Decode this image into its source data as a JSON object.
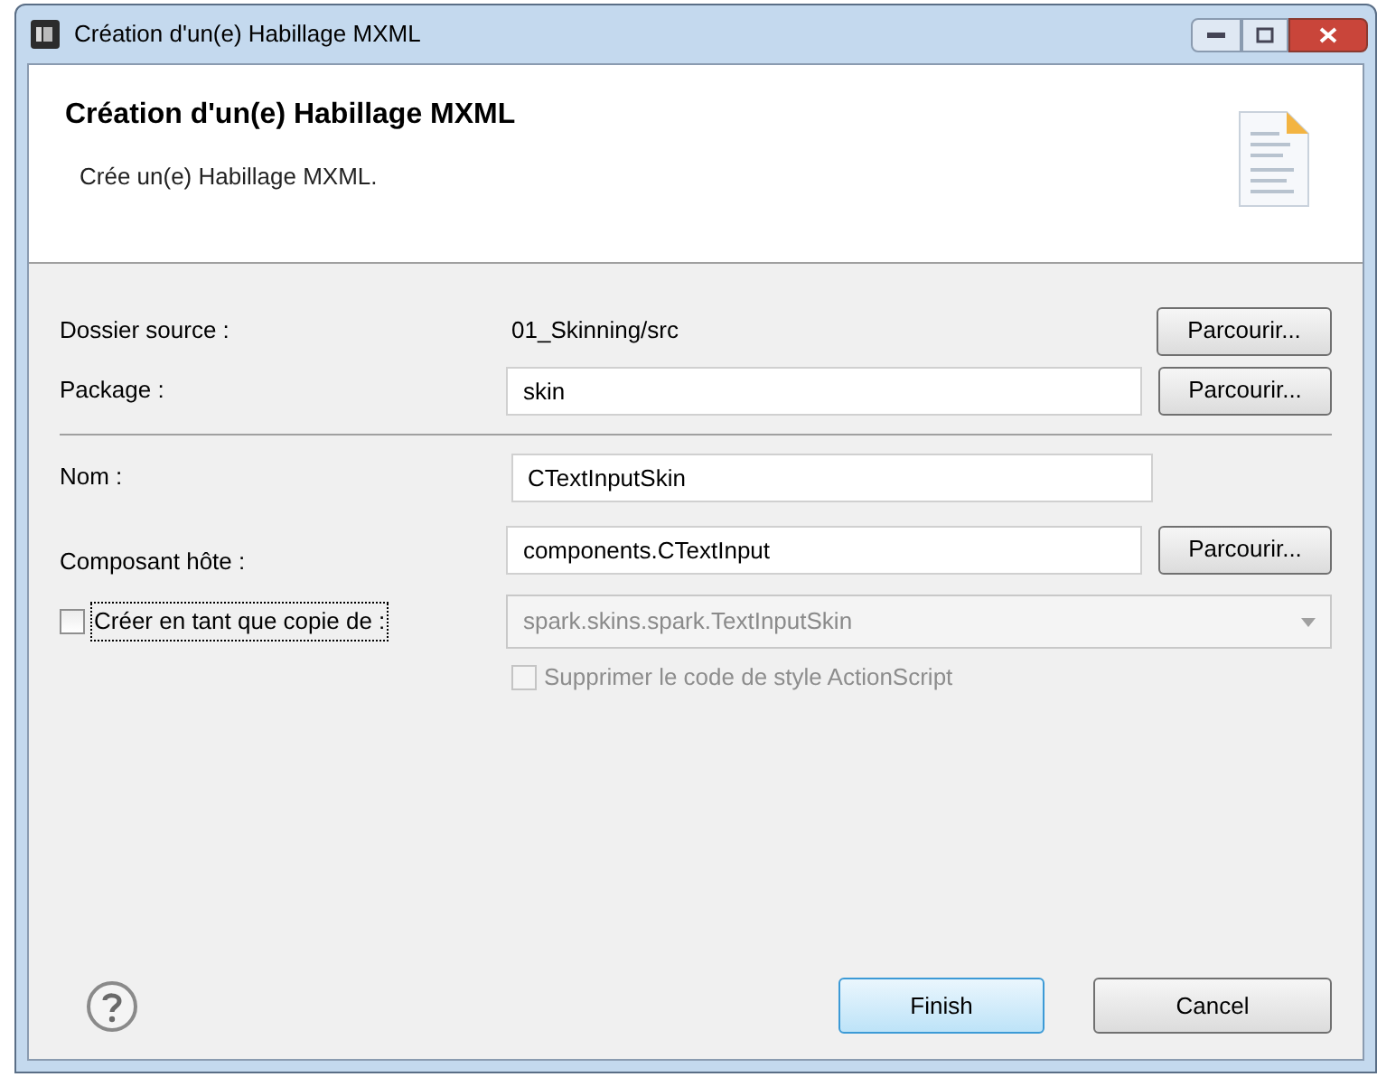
{
  "window": {
    "title": "Création d'un(e) Habillage MXML"
  },
  "header": {
    "title": "Création d'un(e) Habillage MXML",
    "description": "Crée un(e) Habillage MXML."
  },
  "source_folder": {
    "label": "Dossier source :",
    "value": "01_Skinning/src",
    "button": "Parcourir..."
  },
  "package": {
    "label": "Package :",
    "value": "skin",
    "button": "Parcourir..."
  },
  "name": {
    "label": "Nom :",
    "value": "CTextInputSkin"
  },
  "host_component": {
    "label": "Composant hôte :",
    "value": "components.CTextInput",
    "button": "Parcourir..."
  },
  "copy_of": {
    "label": "Créer en tant que copie de :",
    "checked": false,
    "value": "spark.skins.spark.TextInputSkin",
    "disabled": true
  },
  "remove_style_code": {
    "label": "Supprimer le code de style ActionScript",
    "checked": false,
    "disabled": true
  },
  "buttons": [
    {
      "label": "Finish",
      "kind": "default"
    },
    {
      "label": "Cancel",
      "kind": "normal"
    }
  ]
}
